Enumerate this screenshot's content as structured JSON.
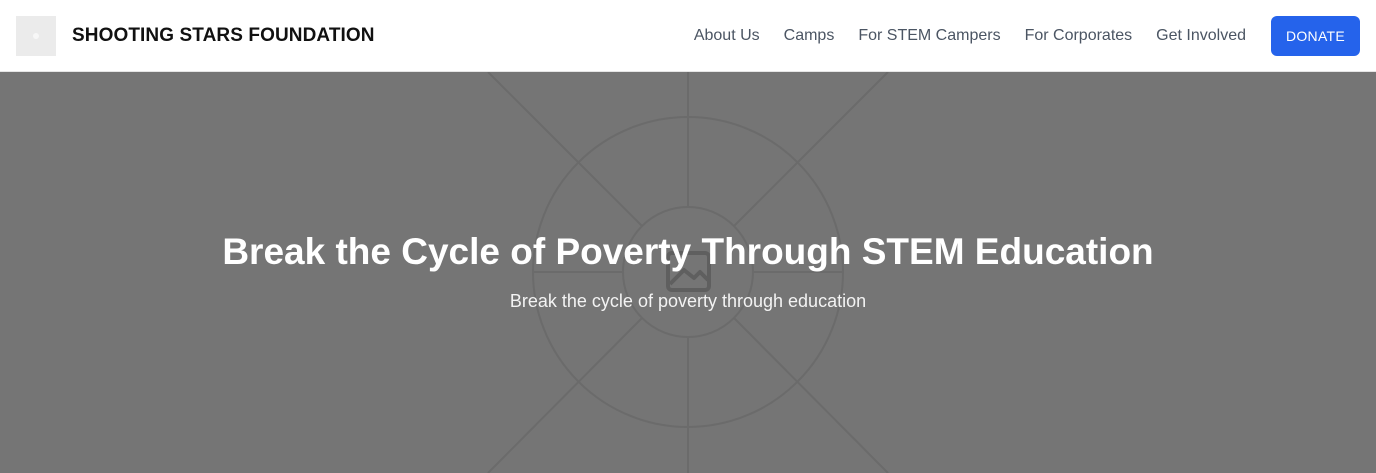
{
  "header": {
    "brand": "SHOOTING STARS FOUNDATION",
    "logo_icon": "logo-placeholder-icon",
    "nav": [
      {
        "label": "About Us"
      },
      {
        "label": "Camps"
      },
      {
        "label": "For STEM Campers"
      },
      {
        "label": "For Corporates"
      },
      {
        "label": "Get Involved"
      }
    ],
    "donate_label": "DONATE"
  },
  "hero": {
    "title": "Break the Cycle of Poverty Through STEM Education",
    "subtitle": "Break the cycle of poverty through education",
    "background_icon": "image-placeholder-icon"
  },
  "colors": {
    "accent": "#2563eb",
    "hero_bg": "#757575",
    "nav_text": "#4b5563"
  }
}
